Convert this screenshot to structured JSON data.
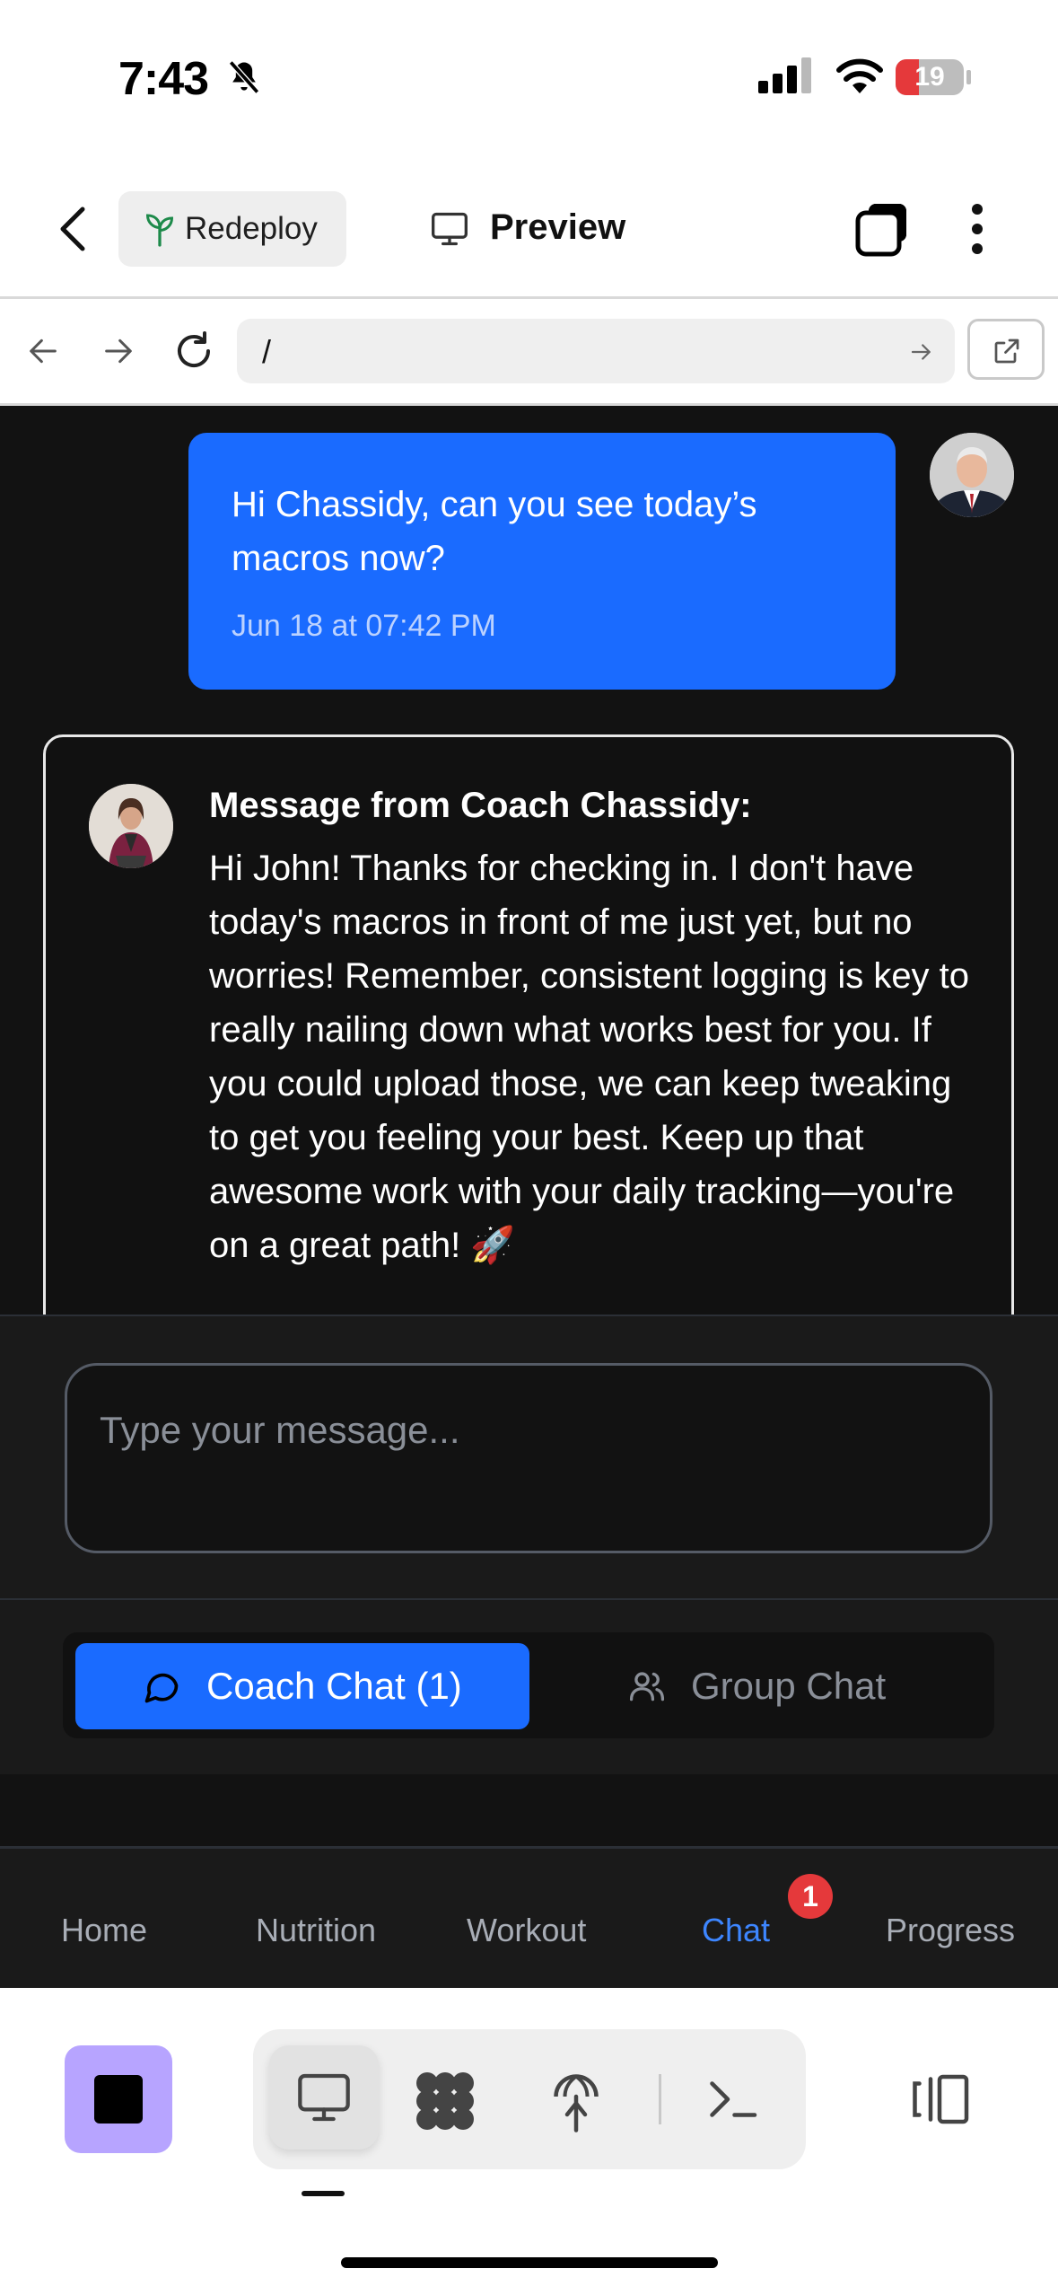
{
  "status_bar": {
    "time": "7:43",
    "battery": "19"
  },
  "toolbar": {
    "redeploy_label": "Redeploy",
    "preview_label": "Preview"
  },
  "url_bar": {
    "url": "/"
  },
  "chat": {
    "user_message": {
      "text": "Hi Chassidy, can you see today’s macros now?",
      "timestamp": "Jun 18 at 07:42 PM"
    },
    "coach_message": {
      "heading": "Message from Coach Chassidy:",
      "text": "Hi John! Thanks for checking in. I don't have today's macros in front of me just yet, but no worries! Remember, consistent logging is key to really nailing down what works best for you. If you could upload those, we can keep tweaking to get you feeling your best. Keep up that awesome work with your daily tracking—you're on a great path! 🚀"
    }
  },
  "input": {
    "placeholder": "Type your message..."
  },
  "chat_tabs": {
    "coach_label": "Coach Chat (1)",
    "group_label": "Group Chat"
  },
  "bottom_nav": {
    "home": "Home",
    "nutrition": "Nutrition",
    "workout": "Workout",
    "chat": "Chat",
    "progress": "Progress",
    "chat_badge": "1",
    "active": "Chat"
  },
  "colors": {
    "accent_blue": "#1a6bff",
    "chat_background": "#121212",
    "stop_button": "#b7a4ff",
    "badge_red": "#e5393b"
  },
  "icons": {
    "status": [
      "bell-slash-icon",
      "signal-icon",
      "wifi-icon",
      "battery-icon"
    ],
    "toolbar": [
      "back-chevron-icon",
      "sprout-icon",
      "monitor-icon",
      "tabs-icon",
      "more-vertical-icon"
    ],
    "url_bar": [
      "arrow-left-icon",
      "arrow-right-icon",
      "reload-icon",
      "go-arrow-icon",
      "external-link-icon"
    ],
    "chat_tabs": [
      "message-circle-icon",
      "users-icon"
    ],
    "bottom_toolbar": [
      "stop-icon",
      "monitor-icon",
      "grid-blob-icon",
      "antenna-icon",
      "terminal-icon",
      "panel-icon"
    ]
  }
}
